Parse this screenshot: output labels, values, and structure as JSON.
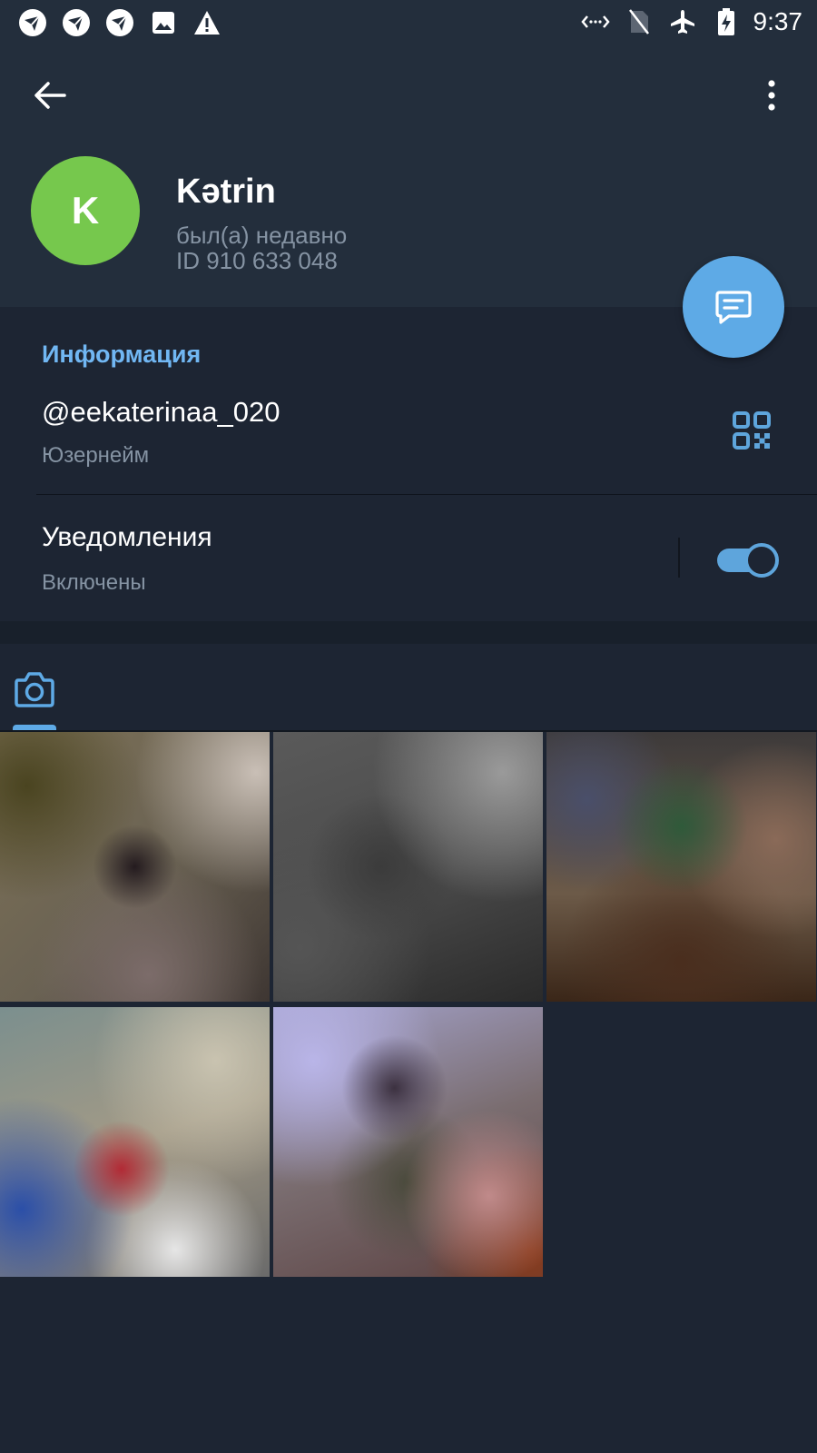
{
  "status_bar": {
    "time": "9:37",
    "left_icons": [
      "app-notification-icon",
      "app-notification-icon",
      "app-notification-icon",
      "image-icon",
      "warning-icon"
    ],
    "right_icons": [
      "data-saver-icon",
      "no-sim-icon",
      "airplane-icon",
      "battery-charging-icon"
    ]
  },
  "toolbar": {
    "back_icon": "arrow-left-icon",
    "menu_icon": "more-vertical-icon"
  },
  "profile": {
    "avatar_letter": "K",
    "avatar_color": "#76c84d",
    "name": "Kətrin",
    "last_seen": "был(а) недавно",
    "id_text": "ID 910 633 048"
  },
  "fab": {
    "icon": "message-icon",
    "color": "#5eaae6"
  },
  "info": {
    "section_title": "Информация",
    "username": "@eekaterinaa_020",
    "username_label": "Юзернейм",
    "qr_icon": "qr-code-icon",
    "notifications_title": "Уведомления",
    "notifications_status": "Включены",
    "notifications_enabled": true
  },
  "media": {
    "tabs": [
      {
        "icon": "camera-icon",
        "active": true
      }
    ],
    "photo_count": 5
  },
  "colors": {
    "accent": "#5eaae6",
    "section_title": "#71b7f3",
    "background": "#1d2533",
    "header": "#232e3c",
    "secondary_text": "#8593a3"
  }
}
